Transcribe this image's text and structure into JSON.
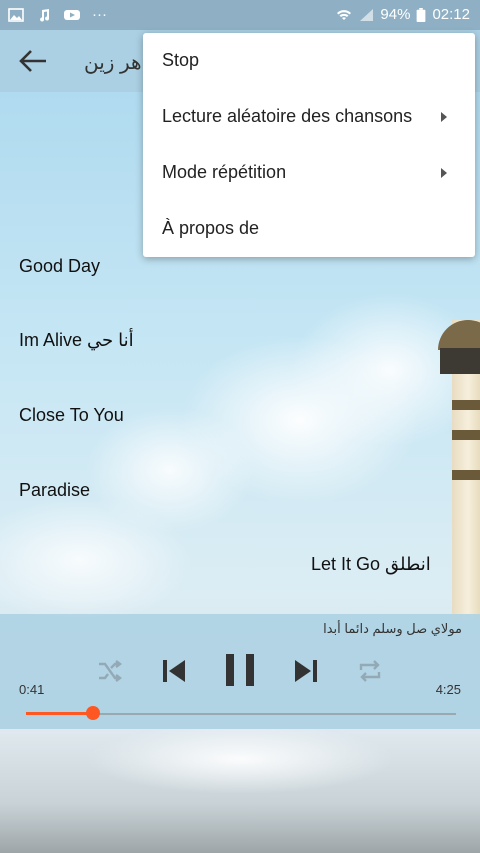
{
  "status_bar": {
    "battery": "94%",
    "time": "02:12",
    "overflow": "···"
  },
  "app_bar": {
    "title": "هر زين"
  },
  "menu": {
    "items": [
      {
        "label": "Stop",
        "has_submenu": false
      },
      {
        "label": "Lecture aléatoire des chansons",
        "has_submenu": true
      },
      {
        "label": "Mode répétition",
        "has_submenu": true
      },
      {
        "label": "À propos de",
        "has_submenu": false
      }
    ]
  },
  "songs": [
    {
      "label": "Good Day"
    },
    {
      "label": "Im Alive أنا حي"
    },
    {
      "label": "Close To You"
    },
    {
      "label": "Paradise"
    },
    {
      "label": "Let It Go انطلق"
    }
  ],
  "player": {
    "now_playing": "مولاي صل وسلم دائما أبدا",
    "current_time": "0:41",
    "total_time": "4:25",
    "progress": 0.155,
    "accent_color": "#ff5722",
    "controls": [
      "shuffle-icon",
      "previous-icon",
      "pause-icon",
      "next-icon",
      "repeat-icon"
    ]
  }
}
